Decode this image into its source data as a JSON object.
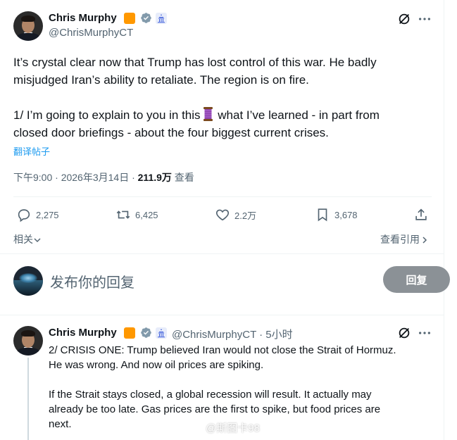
{
  "main_tweet": {
    "author_name": "Chris Murphy",
    "handle": "@ChrisMurphyCT",
    "lines": [
      "It’s crystal clear now that Trump has lost control of this war. He badly",
      "misjudged Iran’s ability to retaliate. The region is on fire.",
      "1/ I’m going to explain to you in this",
      " what I’ve learned - in part from",
      "closed door briefings - about the four biggest current crises."
    ],
    "translate_label": "翻译帖子",
    "timestamp": "下午9:00 · 2026年3月14日 · ",
    "views": "211.9万",
    "views_label": "查看",
    "actions": {
      "replies": "2,275",
      "reposts": "6,425",
      "likes": "2.2万",
      "bookmarks": "3,678"
    },
    "related_label": "相关",
    "view_quotes_label": "查看引用"
  },
  "reply_box": {
    "placeholder": "发布你的回复",
    "button_label": "回复"
  },
  "reply_tweet": {
    "author_name": "Chris Murphy",
    "handle_time": "@ChrisMurphyCT · 5小时",
    "lines": [
      "2/ CRISIS ONE: Trump believed Iran would not close the Strait of Hormuz.",
      "He was wrong. And now oil prices are spiking.",
      "If the Strait stays closed, a global recession will result. It actually may",
      "already be too late. Gas prices are the first to spike, but food prices are",
      "next."
    ]
  },
  "watermark": "@斯图卡98",
  "colors": {
    "accent": "#1d9bf0",
    "secondary_text": "#536471",
    "badge_orange": "#ff9800",
    "verified": "#829aab"
  }
}
